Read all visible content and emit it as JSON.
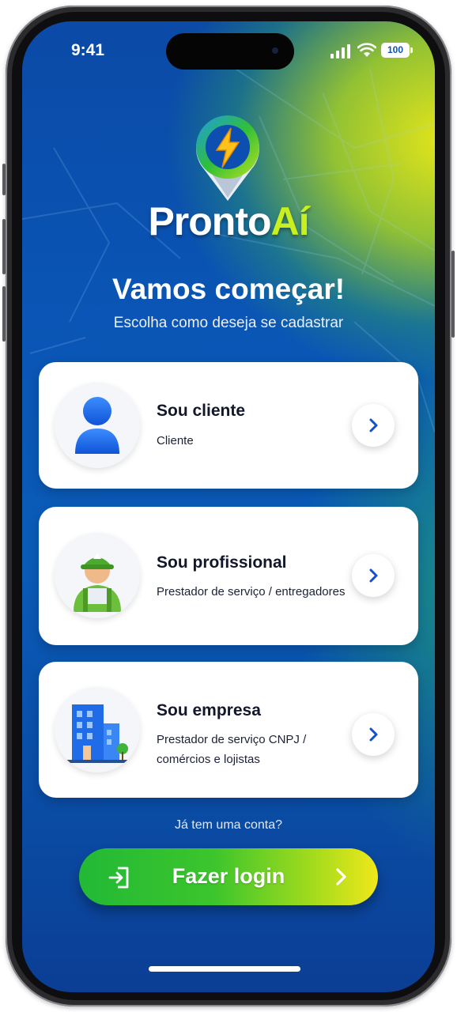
{
  "status_bar": {
    "time": "9:41",
    "battery": "100"
  },
  "brand": {
    "part1": "Pronto",
    "part2": "Aí"
  },
  "header": {
    "title": "Vamos começar!",
    "subtitle": "Escolha como deseja se cadastrar"
  },
  "options": [
    {
      "title": "Sou cliente",
      "subtitle": "Cliente",
      "icon": "user-icon"
    },
    {
      "title": "Sou profissional",
      "subtitle": "Prestador de serviço / entregadores",
      "icon": "worker-icon"
    },
    {
      "title": "Sou empresa",
      "subtitle": "Prestador de serviço CNPJ / comércios e lojistas",
      "icon": "building-icon"
    }
  ],
  "footer": {
    "prompt": "Já tem uma conta?",
    "login_label": "Fazer login"
  },
  "colors": {
    "brand_blue": "#0a55b5",
    "accent_green": "#22b936",
    "accent_yellow": "#f0e81a",
    "brand_lime": "#c9ef1e"
  }
}
